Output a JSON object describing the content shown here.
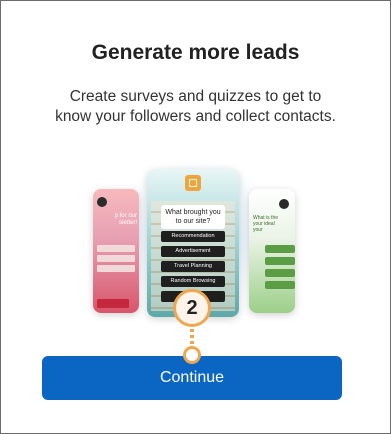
{
  "dialog": {
    "title": "Generate more leads",
    "subtitle_line1": "Create surveys and quizzes to get to",
    "subtitle_line2": "know your followers and collect contacts.",
    "continue_label": "Continue",
    "step_number": "2"
  },
  "preview": {
    "left_phone": {
      "heading": "p for our\nsletter!",
      "fields": [
        "",
        "",
        ""
      ]
    },
    "center_phone": {
      "question": "What brought you to our site?",
      "options": [
        "Recommendation",
        "Advertisement",
        "Travel Planning",
        "Random Browsing",
        ""
      ]
    },
    "right_phone": {
      "heading": "What is the\nyour ideal\nyour"
    }
  },
  "colors": {
    "accent": "#0a66c2",
    "step_highlight": "#f0a550"
  }
}
